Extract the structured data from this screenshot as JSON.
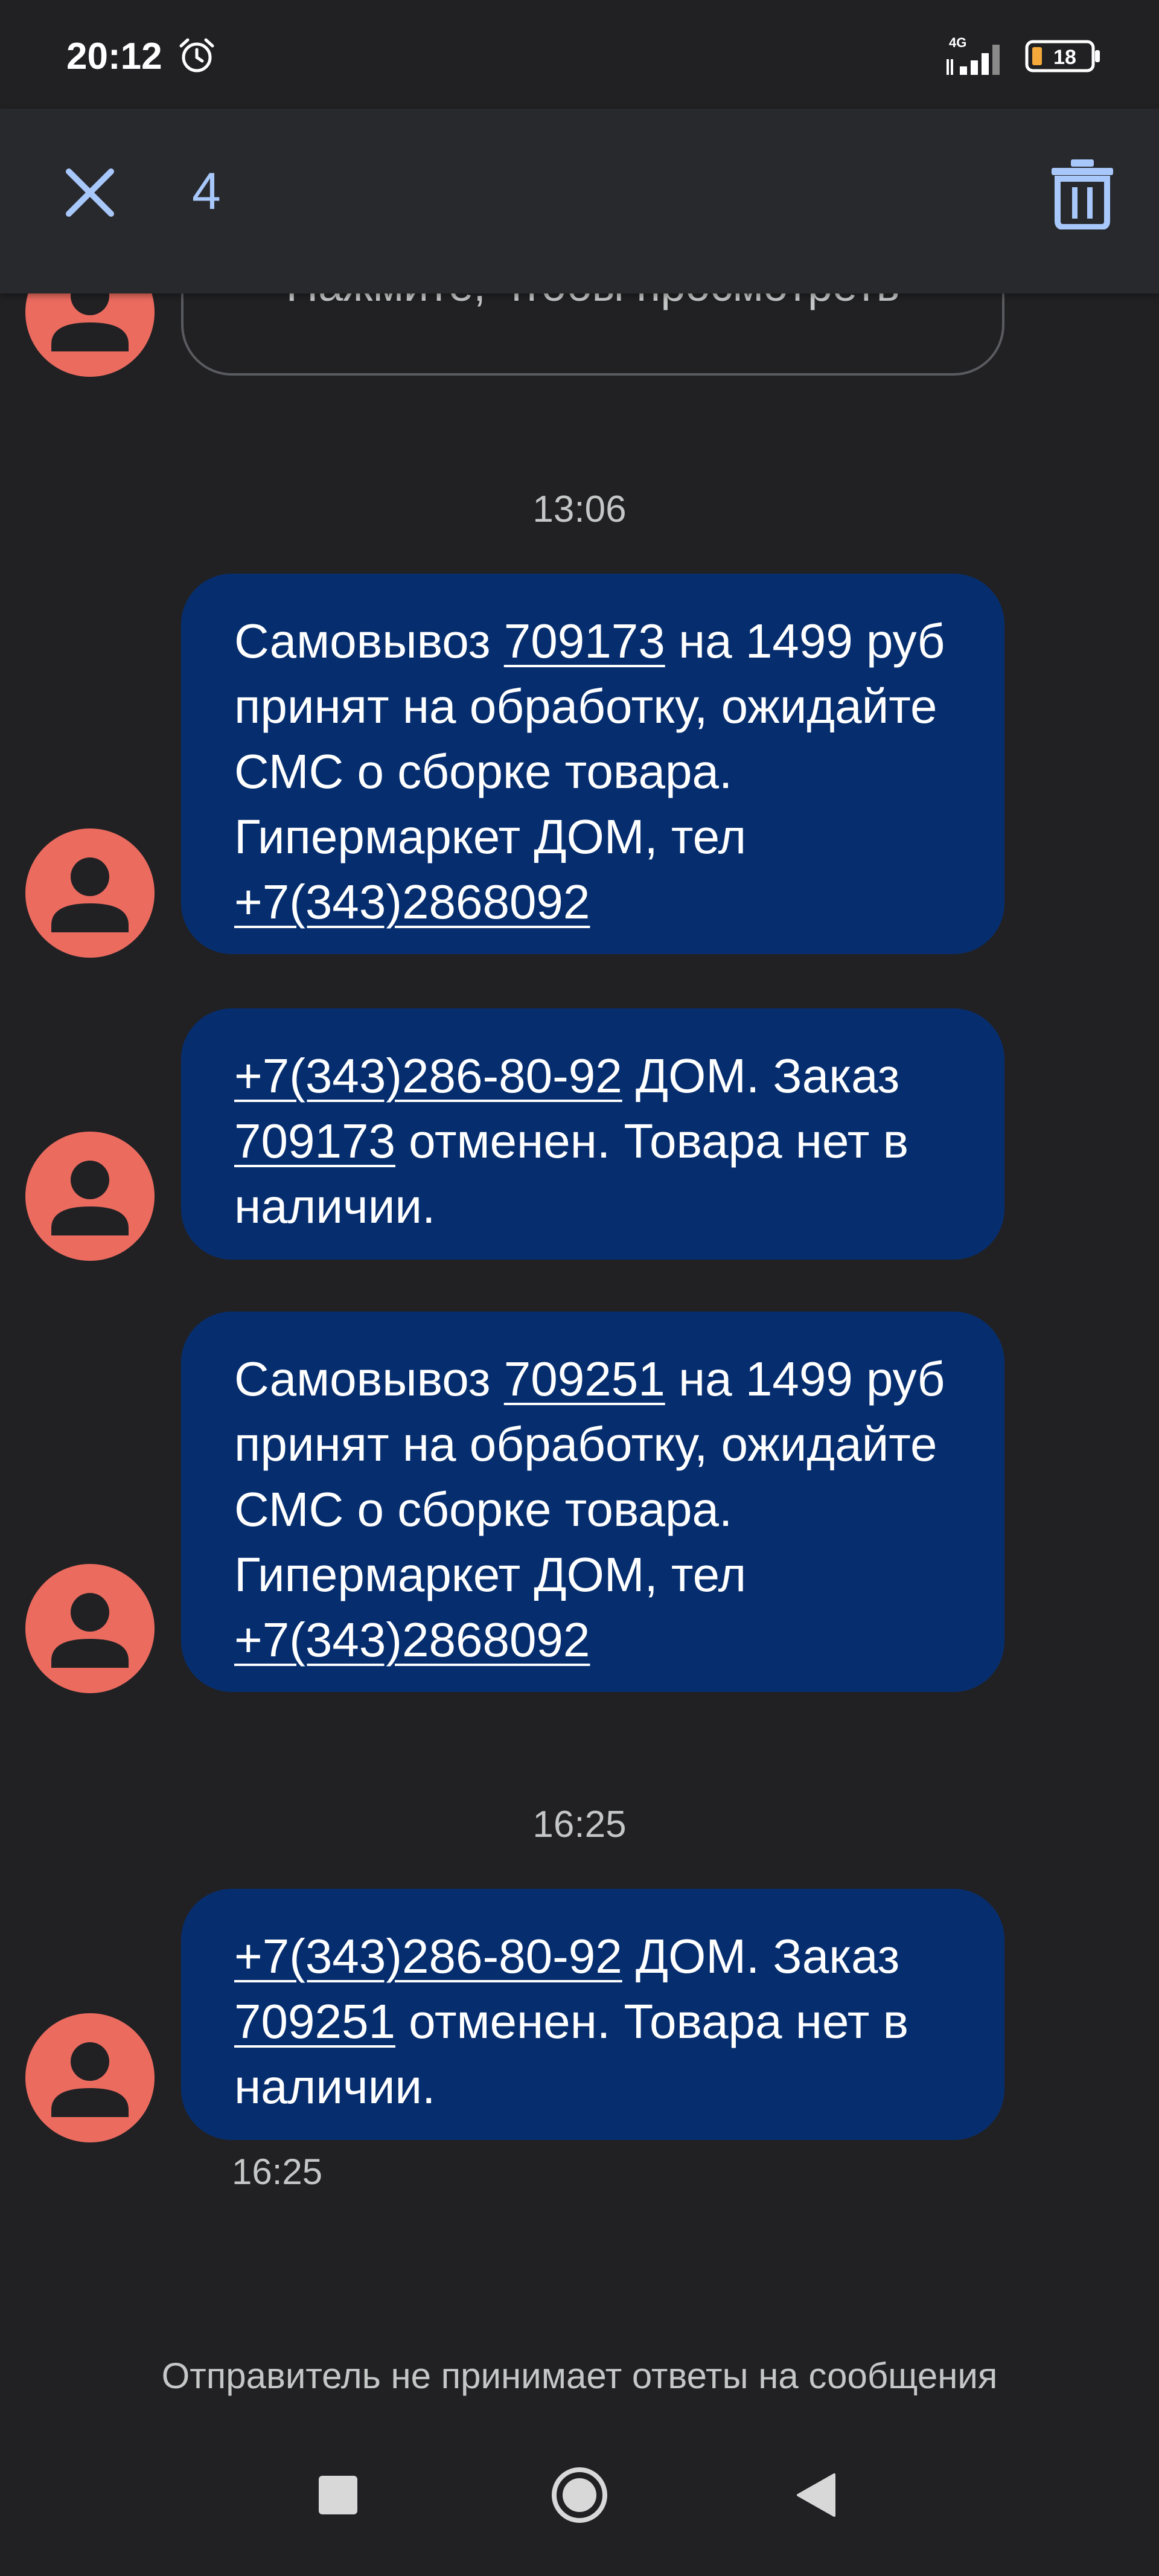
{
  "status_bar": {
    "time": "20:12",
    "network": "4G",
    "battery": "18",
    "icons": [
      "alarm-icon",
      "signal-icon",
      "battery-icon"
    ]
  },
  "app_bar": {
    "close_icon": "close-icon",
    "selected_count": "4",
    "delete_icon": "trash-icon"
  },
  "thread": {
    "partial_message": "Нажмите, чтобы просмотреть",
    "timestamps": [
      "13:06",
      "16:25"
    ],
    "messages": [
      {
        "parts": [
          "Самовывоз ",
          "709173",
          " на 1499 руб принят на обработку, ожидайте СМС о сборке товара. Гипермаркет ДОМ, тел ",
          "+7(343)2868092",
          ""
        ],
        "links": [
          1,
          3
        ]
      },
      {
        "parts": [
          "+7(343)286-80-92",
          " ДОМ. Заказ ",
          "709173",
          " отменен. Товара нет в наличии."
        ],
        "links": [
          0,
          2
        ]
      },
      {
        "parts": [
          "Самовывоз ",
          "709251",
          " на 1499 руб принят на обработку, ожидайте СМС о сборке товара. Гипермаркет ДОМ, тел ",
          "+7(343)2868092",
          ""
        ],
        "links": [
          1,
          3
        ]
      },
      {
        "parts": [
          "+7(343)286-80-92",
          " ДОМ. Заказ ",
          "709251",
          " отменен. Товара нет в наличии."
        ],
        "links": [
          0,
          2
        ]
      }
    ],
    "last_message_time": "16:25",
    "no_reply_notice": "Отправитель не принимает ответы на сообщения"
  },
  "nav_bar": {
    "buttons": [
      "recents-button",
      "home-button",
      "back-button"
    ]
  },
  "colors": {
    "background": "#212124",
    "bubble": "#062e6f",
    "avatar": "#ec6b5f",
    "accent": "#a8c7fa"
  }
}
